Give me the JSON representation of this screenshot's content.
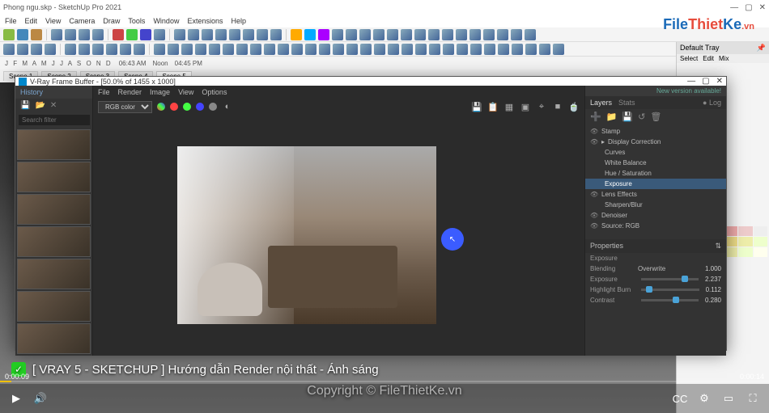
{
  "sketchup": {
    "title": "Phong ngu.skp - SketchUp Pro 2021",
    "menu": [
      "File",
      "Edit",
      "View",
      "Camera",
      "Draw",
      "Tools",
      "Window",
      "Extensions",
      "Help"
    ],
    "time": {
      "letters": "J F M A M J J A S O N D",
      "t1": "06:43 AM",
      "noon": "Noon",
      "t2": "04:45 PM"
    },
    "scenes": [
      "Scene 1",
      "Scene 2",
      "Scene 3",
      "Scene 4",
      "Scene 5"
    ]
  },
  "tray": {
    "title": "Default Tray",
    "sub": [
      "Select",
      "Edit",
      "Mix"
    ]
  },
  "vfb": {
    "title": "V-Ray Frame Buffer - [50.0% of 1455 x 1000]",
    "history_label": "History",
    "search_ph": "Search filter",
    "menu": [
      "File",
      "Render",
      "Image",
      "View",
      "Options"
    ],
    "channel": "RGB color",
    "update": "New version available!",
    "tabs": [
      "Layers",
      "Stats",
      "Log"
    ],
    "layers": {
      "stamp": "Stamp",
      "display": "Display Correction",
      "curves": "Curves",
      "wb": "White Balance",
      "hue": "Hue / Saturation",
      "exposure": "Exposure",
      "lens": "Lens Effects",
      "sharpen": "Sharpen/Blur",
      "denoiser": "Denoiser",
      "source": "Source: RGB"
    },
    "props": {
      "header": "Properties",
      "exposure_lbl": "Exposure",
      "blending_lbl": "Blending",
      "blending_val": "Overwrite",
      "exp_val": "1.000",
      "exp2_val": "2.237",
      "hb_lbl": "Highlight Burn",
      "hb_val": "0.112",
      "ct_lbl": "Contrast",
      "ct_val": "0.280"
    }
  },
  "watermark": {
    "p1": "File",
    "p2": "Thiet",
    "p3": "Ke",
    "vn": ".vn"
  },
  "caption": "[ VRAY 5 - SKETCHUP ] Hướng dẫn Render nội thất - Ánh sáng",
  "copyright": "Copyright © FileThietKe.vn",
  "player": {
    "time_l": "0:00:09",
    "time_r": "0:00:14"
  }
}
